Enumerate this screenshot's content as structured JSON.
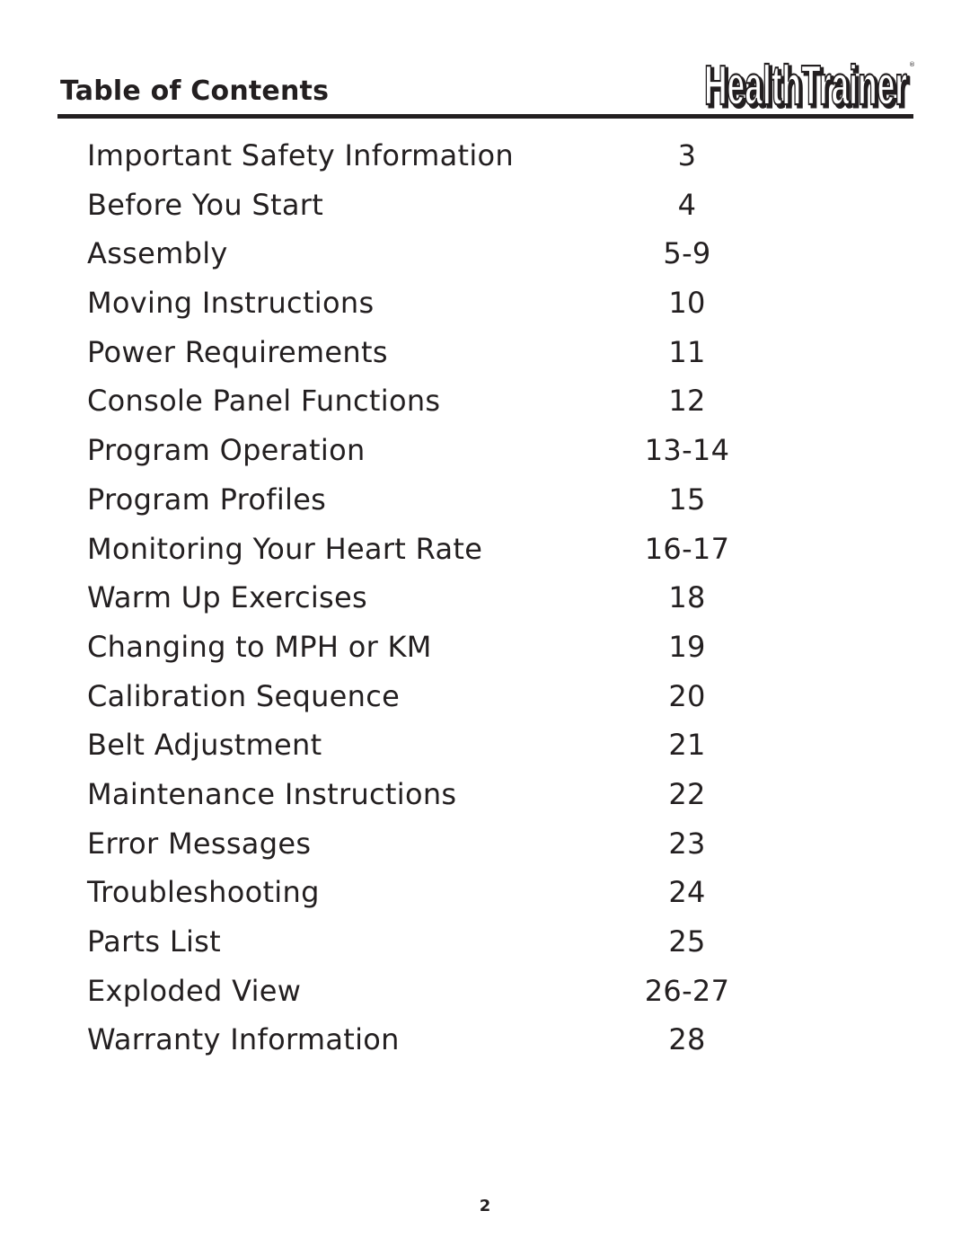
{
  "header": {
    "title": "Table of Contents",
    "brand_logo_text": "HealthTrainer",
    "brand_trademark": "®"
  },
  "toc": {
    "entries": [
      {
        "label": "Important Safety Information",
        "page": "3"
      },
      {
        "label": "Before You Start",
        "page": "4"
      },
      {
        "label": "Assembly",
        "page": "5-9"
      },
      {
        "label": "Moving Instructions",
        "page": "10"
      },
      {
        "label": "Power Requirements",
        "page": "11"
      },
      {
        "label": "Console Panel Functions",
        "page": "12"
      },
      {
        "label": "Program Operation",
        "page": "13-14"
      },
      {
        "label": "Program Profiles",
        "page": "15"
      },
      {
        "label": "Monitoring Your Heart Rate",
        "page": "16-17"
      },
      {
        "label": "Warm Up Exercises",
        "page": "18"
      },
      {
        "label": "Changing to MPH or KM",
        "page": "19"
      },
      {
        "label": "Calibration Sequence",
        "page": "20"
      },
      {
        "label": "Belt Adjustment",
        "page": "21"
      },
      {
        "label": "Maintenance Instructions",
        "page": "22"
      },
      {
        "label": "Error Messages",
        "page": "23"
      },
      {
        "label": "Troubleshooting",
        "page": "24"
      },
      {
        "label": "Parts List",
        "page": "25"
      },
      {
        "label": "Exploded View",
        "page": "26-27"
      },
      {
        "label": "Warranty Information",
        "page": "28"
      }
    ]
  },
  "footer": {
    "page_number": "2"
  },
  "colors": {
    "text": "#231f20",
    "background": "#ffffff"
  }
}
